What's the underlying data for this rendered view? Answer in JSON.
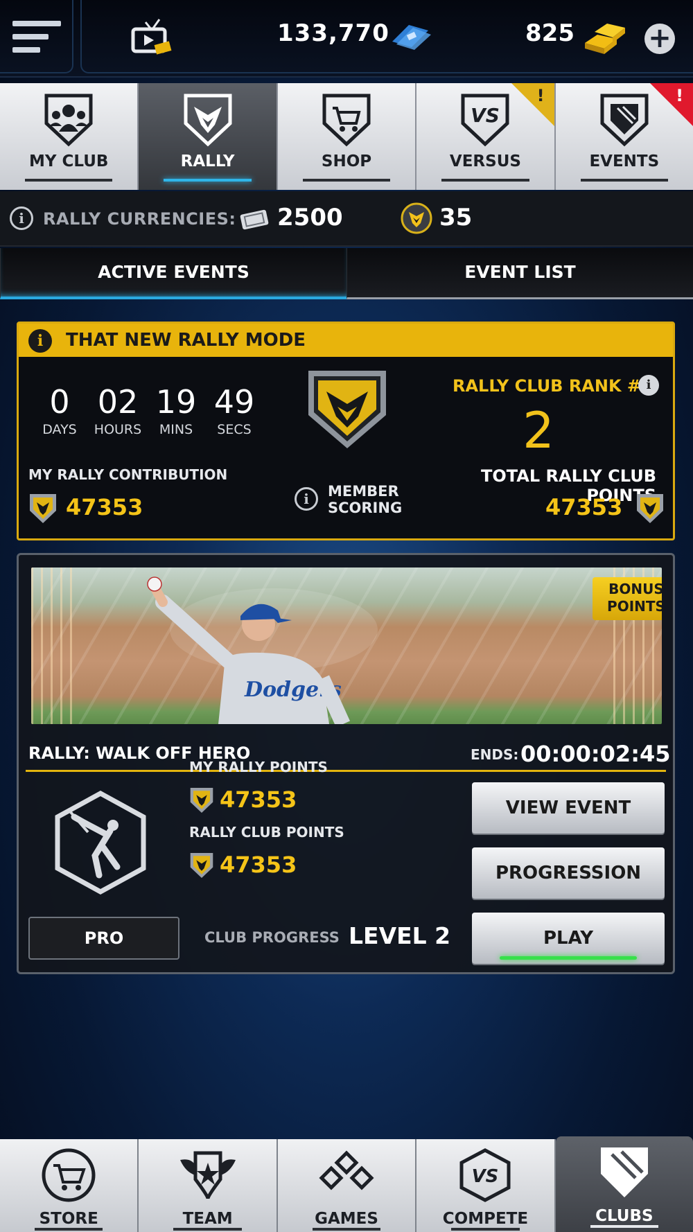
{
  "header": {
    "coins": "133,770",
    "gold": "825",
    "icons": [
      "menu-icon",
      "video-reward-icon",
      "stubs-icon",
      "gold-bars-icon",
      "plus-icon"
    ]
  },
  "top_tabs": [
    {
      "label": "MY CLUB",
      "icon": "club-members-icon",
      "active": false
    },
    {
      "label": "RALLY",
      "icon": "rally-shield-icon",
      "active": true
    },
    {
      "label": "SHOP",
      "icon": "shop-cart-icon",
      "active": false
    },
    {
      "label": "VERSUS",
      "icon": "versus-icon",
      "active": false,
      "alert": "!"
    },
    {
      "label": "EVENTS",
      "icon": "events-plate-icon",
      "active": false,
      "alert": "!"
    }
  ],
  "currencies": {
    "label": "RALLY CURRENCIES:",
    "ticket_value": "2500",
    "badge_value": "35"
  },
  "sub_tabs": {
    "active": "ACTIVE EVENTS",
    "list": "EVENT LIST"
  },
  "event": {
    "title": "THAT NEW RALLY MODE",
    "timer": [
      {
        "value": "0",
        "label": "DAYS"
      },
      {
        "value": "02",
        "label": "HOURS"
      },
      {
        "value": "19",
        "label": "MINS"
      },
      {
        "value": "49",
        "label": "SECS"
      }
    ],
    "rank_label": "RALLY CLUB RANK #",
    "rank_value": "2",
    "contribution_label": "MY RALLY CONTRIBUTION",
    "contribution_value": "47353",
    "member_scoring_line1": "MEMBER",
    "member_scoring_line2": "SCORING",
    "total_label": "TOTAL RALLY CLUB POINTS",
    "total_value": "47353"
  },
  "rally": {
    "bonus_line1": "BONUS",
    "bonus_line2": "POINTS",
    "jersey_text": "Dodgers",
    "name": "RALLY: WALK OFF HERO",
    "ends_label": "ENDS:",
    "ends_value": "00:00:02:45",
    "my_points_label": "MY RALLY POINTS",
    "my_points_value": "47353",
    "club_points_label": "RALLY CLUB POINTS",
    "club_points_value": "47353",
    "view_event": "VIEW EVENT",
    "progression": "PROGRESSION",
    "play": "PLAY",
    "difficulty": "PRO",
    "club_progress_label": "CLUB PROGRESS",
    "club_progress_value": "LEVEL 2"
  },
  "bottom_nav": [
    {
      "label": "STORE",
      "icon": "store-cart-icon",
      "active": false
    },
    {
      "label": "TEAM",
      "icon": "team-wings-icon",
      "active": false
    },
    {
      "label": "GAMES",
      "icon": "games-diamonds-icon",
      "active": false
    },
    {
      "label": "COMPETE",
      "icon": "compete-vs-icon",
      "active": false
    },
    {
      "label": "CLUBS",
      "icon": "clubs-plate-icon",
      "active": true
    }
  ],
  "colors": {
    "accent_gold": "#e8b40c",
    "accent_blue": "#2aa9e0",
    "play_glow": "#37e04a"
  }
}
